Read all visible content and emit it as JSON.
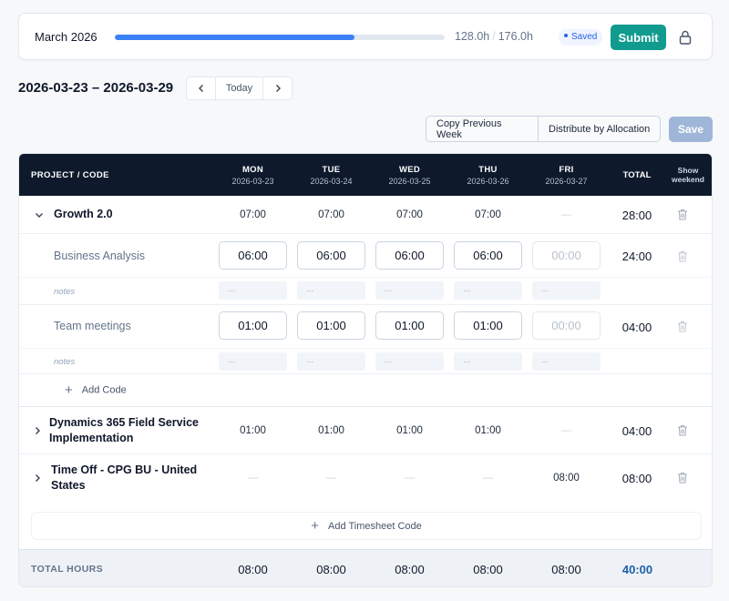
{
  "summary": {
    "month": "March 2026",
    "logged_hours": "128.0h",
    "separator": "/",
    "target_hours": "176.0h",
    "progress_fraction": 0.727,
    "status_badge": "Saved",
    "submit_label": "Submit",
    "lock_icon": "lock-icon"
  },
  "week": {
    "range": "2026-03-23 – 2026-03-29",
    "today_label": "Today",
    "prev_icon": "chevron-left-icon",
    "next_icon": "chevron-right-icon"
  },
  "actions": {
    "copy_previous_week": "Copy Previous Week",
    "distribute_by_allocation": "Distribute by Allocation",
    "save_label": "Save"
  },
  "columns": {
    "project": "PROJECT / CODE",
    "days": [
      {
        "day": "MON",
        "date": "2026-03-23"
      },
      {
        "day": "TUE",
        "date": "2026-03-24"
      },
      {
        "day": "WED",
        "date": "2026-03-25"
      },
      {
        "day": "THU",
        "date": "2026-03-26"
      },
      {
        "day": "FRI",
        "date": "2026-03-27"
      }
    ],
    "total": "TOTAL",
    "show_weekend": [
      "Show",
      "weekend"
    ]
  },
  "projects": [
    {
      "name": "Growth 2.0",
      "expanded": true,
      "days": [
        "07:00",
        "07:00",
        "07:00",
        "07:00",
        "—"
      ],
      "total": "28:00",
      "codes": [
        {
          "name": "Business Analysis",
          "days": [
            "06:00",
            "06:00",
            "06:00",
            "06:00",
            "00:00"
          ],
          "total": "24:00",
          "notes_label": "notes",
          "notes_placeholder": "..."
        },
        {
          "name": "Team meetings",
          "days": [
            "01:00",
            "01:00",
            "01:00",
            "01:00",
            "00:00"
          ],
          "total": "04:00",
          "notes_label": "notes",
          "notes_placeholder": "..."
        }
      ],
      "add_code_label": "Add Code"
    },
    {
      "name_line1": "Dynamics 365 Field Service",
      "name_line2": "Implementation",
      "expanded": false,
      "days": [
        "01:00",
        "01:00",
        "01:00",
        "01:00",
        "—"
      ],
      "total": "04:00"
    },
    {
      "name_line1": "Time Off - CPG BU - United",
      "name_line2": "States",
      "expanded": false,
      "days": [
        "—",
        "—",
        "—",
        "—",
        "08:00"
      ],
      "total": "08:00"
    }
  ],
  "add_timesheet_code": "Add Timesheet Code",
  "footer": {
    "label": "TOTAL HOURS",
    "days": [
      "08:00",
      "08:00",
      "08:00",
      "08:00",
      "08:00"
    ],
    "grand_total": "40:00"
  },
  "colors": {
    "accent_teal": "#109b8e",
    "progress_blue": "#3b82f6",
    "header_navy": "#0e1a2c",
    "grand_total_blue": "#1d5fa8"
  }
}
